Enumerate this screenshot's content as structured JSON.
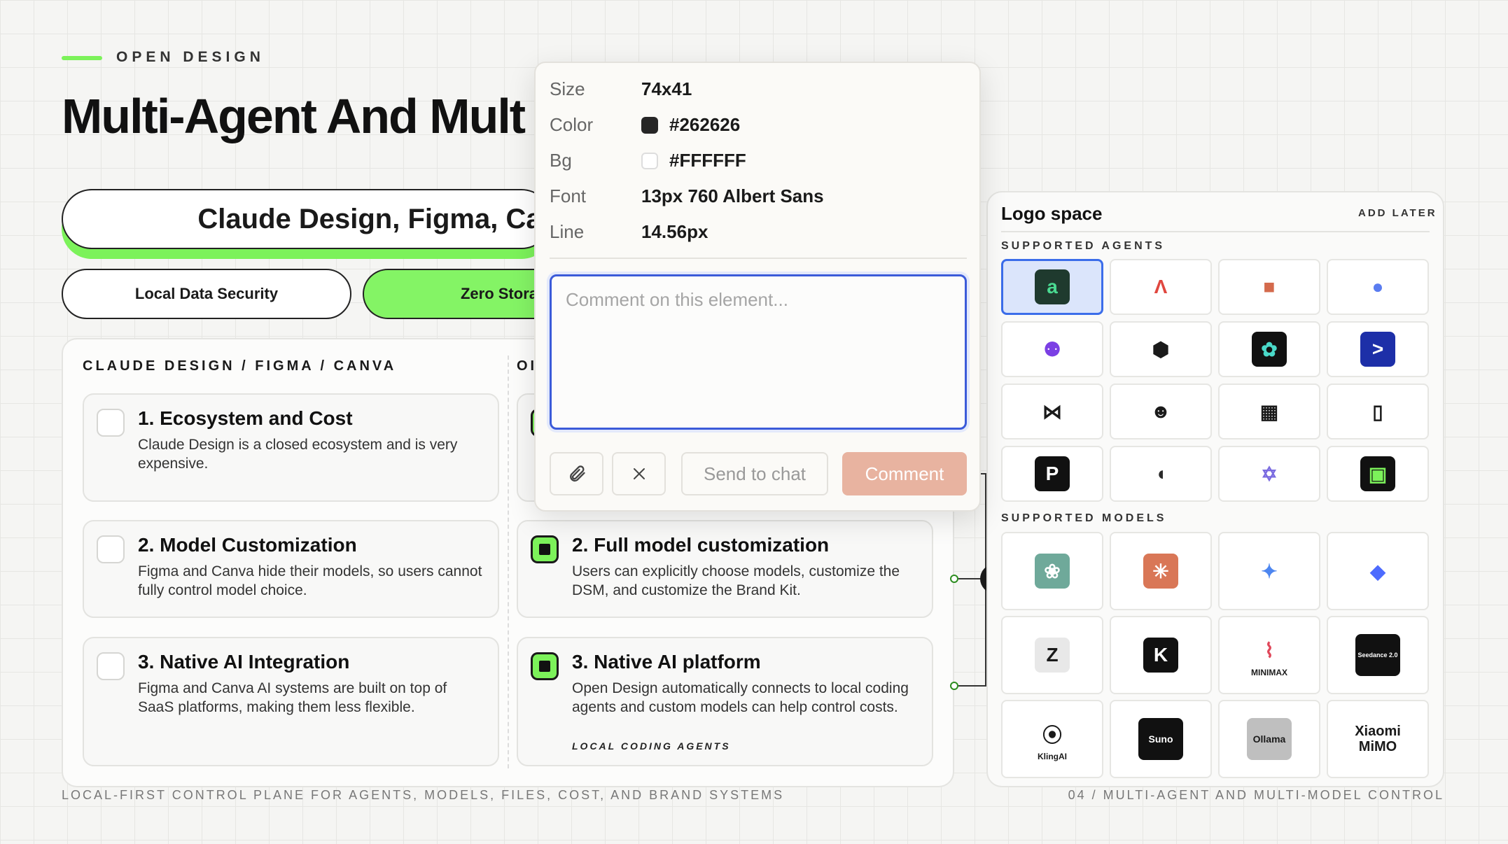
{
  "eyebrow": "OPEN DESIGN",
  "title": "Multi-Agent And Mult",
  "hero": "Claude Design, Figma, Ca",
  "pills": [
    "Local Data Security",
    "Zero Stora"
  ],
  "left_column": {
    "heading": "CLAUDE DESIGN / FIGMA / CANVA",
    "cards": [
      {
        "title": "1. Ecosystem and Cost",
        "body": "Claude Design is a closed ecosystem and is very expensive."
      },
      {
        "title": "2. Model Customization",
        "body": "Figma and Canva hide their models, so users cannot fully control model choice."
      },
      {
        "title": "3. Native AI Integration",
        "body": "Figma and Canva AI systems are built on top of SaaS platforms, making them less flexible."
      }
    ]
  },
  "right_column": {
    "heading": "OI",
    "cards": [
      {
        "title": "",
        "body": ""
      },
      {
        "title": "2. Full model customization",
        "body": "Users can explicitly choose models, customize the DSM, and customize the Brand Kit."
      },
      {
        "title": "3. Native AI platform",
        "body": "Open Design automatically connects to local coding agents and custom models can help control costs.",
        "tag": "LOCAL CODING AGENTS"
      }
    ]
  },
  "footer": {
    "left": "LOCAL-FIRST CONTROL PLANE FOR AGENTS, MODELS, FILES, COST, AND BRAND SYSTEMS",
    "right": "04 / MULTI-AGENT AND MULTI-MODEL CONTROL"
  },
  "logo_panel": {
    "title": "Logo space",
    "later": "ADD LATER",
    "agents_label": "SUPPORTED AGENTS",
    "models_label": "SUPPORTED MODELS",
    "agents": [
      {
        "icon": "amp-icon",
        "glyph": "a",
        "bg": "#1f3a2e",
        "fg": "#4ad991",
        "selected": true
      },
      {
        "icon": "gradient-a-icon",
        "glyph": "Λ",
        "bg": "transparent",
        "fg": "#e0473f"
      },
      {
        "icon": "pixel-crab-icon",
        "glyph": "■",
        "bg": "transparent",
        "fg": "#d46a4c"
      },
      {
        "icon": "blue-bubble-icon",
        "glyph": "●",
        "bg": "transparent",
        "fg": "#5a7cf0"
      },
      {
        "icon": "copilot-icon",
        "glyph": "⚉",
        "bg": "transparent",
        "fg": "#7b3fe4"
      },
      {
        "icon": "cube-icon",
        "glyph": "⬢",
        "bg": "transparent",
        "fg": "#1a1a1a"
      },
      {
        "icon": "flower-icon",
        "glyph": "✿",
        "bg": "#111111",
        "fg": "#4ad9c9"
      },
      {
        "icon": "terminal-arrow-icon",
        "glyph": ">",
        "bg": "#1d2fa8",
        "fg": "#ffffff"
      },
      {
        "icon": "bowtie-icon",
        "glyph": "⋈",
        "bg": "transparent",
        "fg": "#1a1a1a"
      },
      {
        "icon": "portrait-icon",
        "glyph": "☻",
        "bg": "transparent",
        "fg": "#1a1a1a"
      },
      {
        "icon": "qr-icon",
        "glyph": "▦",
        "bg": "transparent",
        "fg": "#1a1a1a"
      },
      {
        "icon": "frame-icon",
        "glyph": "▯",
        "bg": "transparent",
        "fg": "#1a1a1a"
      },
      {
        "icon": "pi-icon",
        "glyph": "P",
        "bg": "#111111",
        "fg": "#ffffff"
      },
      {
        "icon": "leaf-icon",
        "glyph": "◖",
        "bg": "transparent",
        "fg": "#2b2b2b"
      },
      {
        "icon": "star-of-david-icon",
        "glyph": "✡",
        "bg": "transparent",
        "fg": "#7a6be0"
      },
      {
        "icon": "monitor-icon",
        "glyph": "▣",
        "bg": "#111111",
        "fg": "#7cf25a"
      }
    ],
    "models": [
      {
        "icon": "openai-icon",
        "glyph": "❀",
        "bg": "#6fa99a",
        "fg": "#ffffff"
      },
      {
        "icon": "claude-burst-icon",
        "glyph": "✳",
        "bg": "#d97757",
        "fg": "#ffffff"
      },
      {
        "icon": "gemini-star-icon",
        "glyph": "✦",
        "bg": "transparent",
        "fg": "#4d86f0"
      },
      {
        "icon": "deepseek-whale-icon",
        "glyph": "◆",
        "bg": "transparent",
        "fg": "#4d6bfe"
      },
      {
        "icon": "zhipu-z-icon",
        "glyph": "Z",
        "bg": "#e8e8e8",
        "fg": "#1a1a1a"
      },
      {
        "icon": "kimi-k-icon",
        "glyph": "K",
        "bg": "#111111",
        "fg": "#ffffff"
      },
      {
        "icon": "minimax-icon",
        "glyph": "⌇",
        "bg": "transparent",
        "fg": "#e0475a",
        "label": "MINIMAX"
      },
      {
        "icon": "seedance-icon",
        "glyph": "",
        "bg": "#111111",
        "fg": "#ffffff",
        "label": "Seedance 2.0"
      },
      {
        "icon": "kling-icon",
        "glyph": "⦿",
        "bg": "transparent",
        "fg": "#1a1a1a",
        "label": "KlingAI"
      },
      {
        "icon": "suno-icon",
        "glyph": "",
        "bg": "#111111",
        "fg": "#ffffff",
        "label": "Suno"
      },
      {
        "icon": "ollama-icon",
        "glyph": "",
        "bg": "#bfbfbf",
        "fg": "#1a1a1a",
        "label": "Ollama"
      },
      {
        "icon": "xiaomi-mimo-icon",
        "glyph": "",
        "bg": "transparent",
        "fg": "#1a1a1a",
        "label": "Xiaomi MiMO"
      }
    ]
  },
  "popup": {
    "rows": [
      {
        "key": "Size",
        "value": "74x41"
      },
      {
        "key": "Color",
        "value": "#262626",
        "swatch": "#262626"
      },
      {
        "key": "Bg",
        "value": "#FFFFFF",
        "swatch": "#FFFFFF"
      },
      {
        "key": "Font",
        "value": "13px 760 Albert Sans"
      },
      {
        "key": "Line",
        "value": "14.56px"
      }
    ],
    "placeholder": "Comment on this element...",
    "send_label": "Send to chat",
    "comment_label": "Comment"
  }
}
